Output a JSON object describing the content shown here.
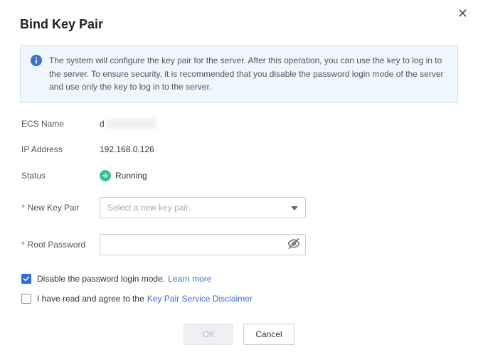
{
  "dialog": {
    "title": "Bind Key Pair",
    "info_text": "The system will configure the key pair for the server. After this operation, you can use the key to log in to the server. To ensure security, it is recommended that you disable the password login mode of the server and use only the key to log in to the server."
  },
  "fields": {
    "ecs_name": {
      "label": "ECS Name",
      "value_prefix": "d"
    },
    "ip_address": {
      "label": "IP Address",
      "value": "192.168.0.126"
    },
    "status": {
      "label": "Status",
      "value": "Running",
      "color": "#3dbf8f"
    },
    "new_key_pair": {
      "label": "New Key Pair",
      "placeholder": "Select a new key pair."
    },
    "root_password": {
      "label": "Root Password",
      "value": ""
    }
  },
  "checkboxes": {
    "disable_pw": {
      "checked": true,
      "label": "Disable the password login mode.",
      "link": "Learn more"
    },
    "agree": {
      "checked": false,
      "label": "I have read and agree to the",
      "link": "Key Pair Service Disclaimer"
    }
  },
  "footer": {
    "ok": "OK",
    "cancel": "Cancel"
  }
}
